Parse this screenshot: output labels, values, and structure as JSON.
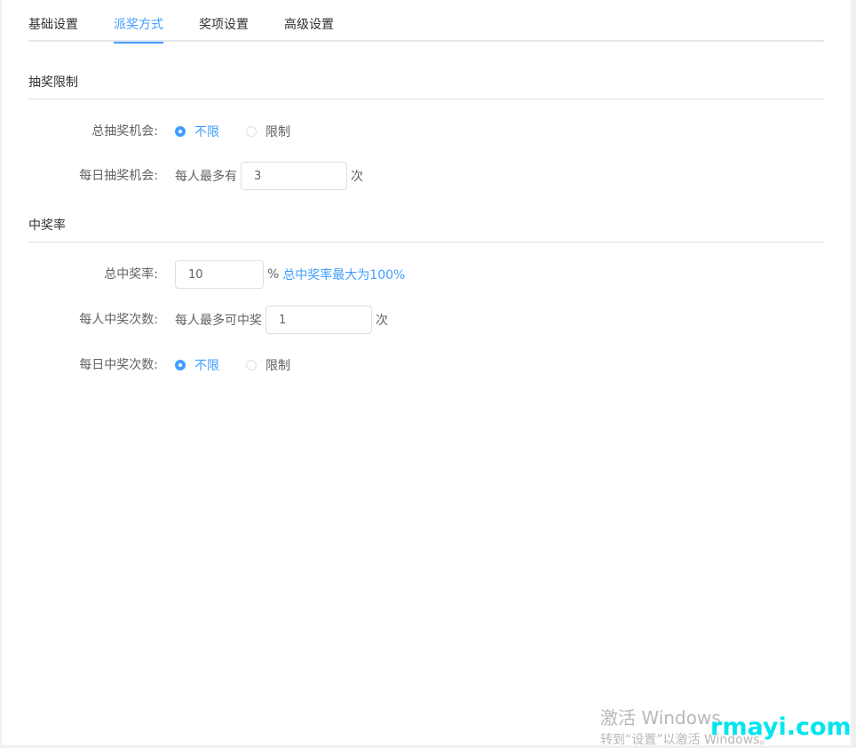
{
  "tabs": [
    {
      "label": "基础设置",
      "active": false
    },
    {
      "label": "派奖方式",
      "active": true
    },
    {
      "label": "奖项设置",
      "active": false
    },
    {
      "label": "高级设置",
      "active": false
    }
  ],
  "sections": {
    "draw_limit": {
      "title": "抽奖限制"
    },
    "win_rate": {
      "title": "中奖率"
    }
  },
  "rows": {
    "total_chances": {
      "label": "总抽奖机会:",
      "options": [
        "不限",
        "限制"
      ],
      "selected": "不限"
    },
    "daily_chances": {
      "label": "每日抽奖机会:",
      "prefix": "每人最多有",
      "value": "3",
      "suffix": "次"
    },
    "total_rate": {
      "label": "总中奖率:",
      "value": "10",
      "suffix": "%",
      "hint": "总中奖率最大为100%"
    },
    "per_person_wins": {
      "label": "每人中奖次数:",
      "prefix": "每人最多可中奖",
      "value": "1",
      "suffix": "次"
    },
    "daily_wins": {
      "label": "每日中奖次数:",
      "options": [
        "不限",
        "限制"
      ],
      "selected": "不限"
    }
  },
  "colors": {
    "accent": "#409eff",
    "text": "#606266",
    "border": "#dcdfe6"
  },
  "watermark": {
    "windows_title": "激活 Windows",
    "windows_sub": "转到“设置”以激活 Windows。",
    "site": "rmayi.com"
  }
}
